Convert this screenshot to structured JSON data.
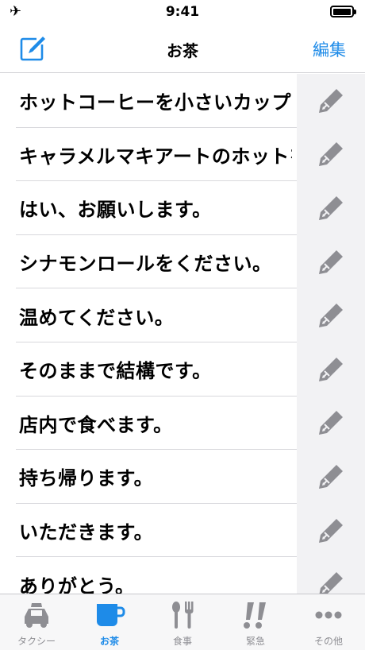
{
  "status": {
    "time": "9:41",
    "airplane": "✈"
  },
  "nav": {
    "title": "お茶",
    "edit_label": "編集"
  },
  "phrases": [
    "ホットコーヒーを小さいカップでお願いします。",
    "キャラメルマキアートのホットをお願いします。",
    "はい、お願いします。",
    "シナモンロールをください。",
    "温めてください。",
    "そのままで結構です。",
    "店内で食べます。",
    "持ち帰ります。",
    "いただきます。",
    "ありがとう。"
  ],
  "tabs": [
    {
      "label": "タクシー",
      "icon": "taxi-icon"
    },
    {
      "label": "お茶",
      "icon": "cup-icon",
      "active": true
    },
    {
      "label": "食事",
      "icon": "utensils-icon"
    },
    {
      "label": "緊急",
      "icon": "exclamation-icon"
    },
    {
      "label": "その他",
      "icon": "more-icon"
    }
  ],
  "colors": {
    "accent": "#1e8be8",
    "icon_gray": "#8e8e93"
  }
}
